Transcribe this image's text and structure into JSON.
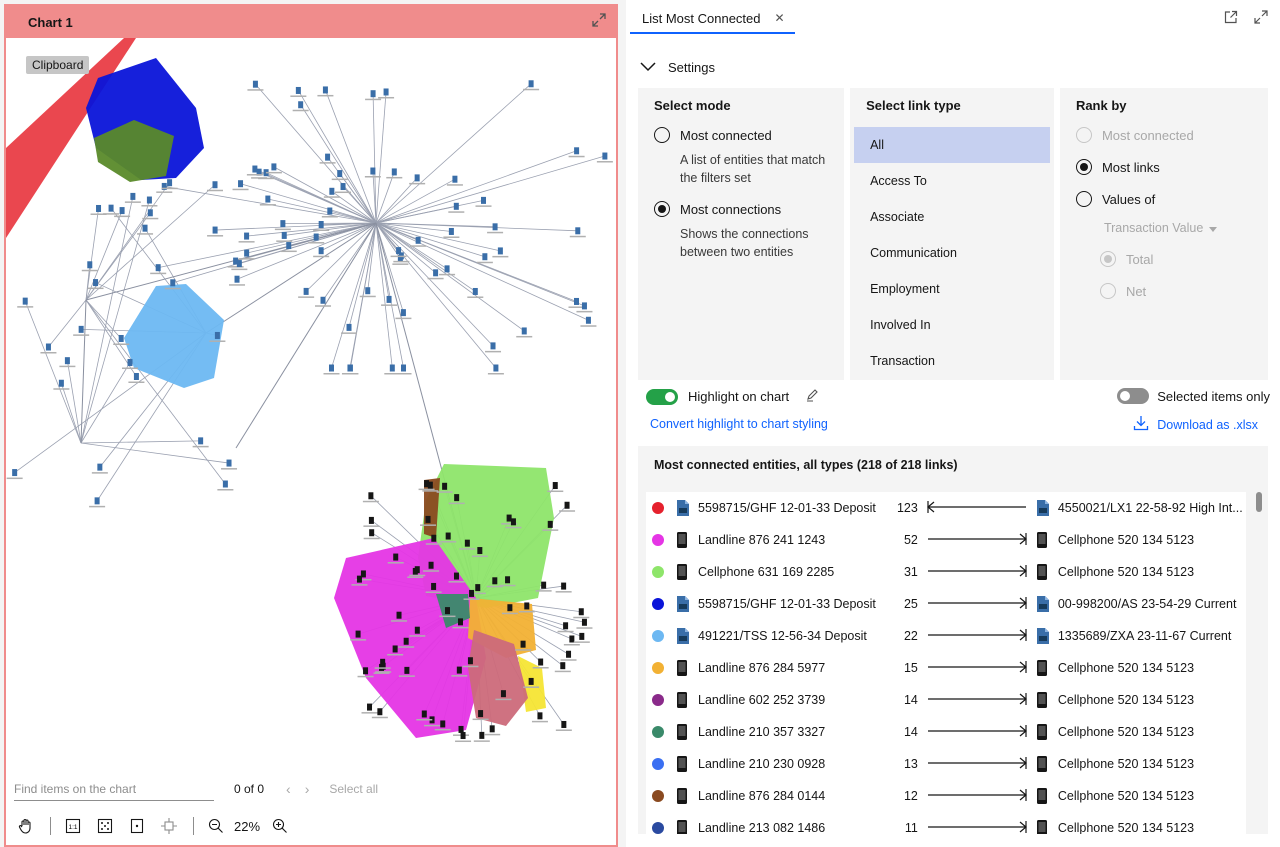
{
  "chart_panel": {
    "title": "Chart 1",
    "tooltip": "Clipboard",
    "find_placeholder": "Find items on the chart",
    "find_count": "0 of 0",
    "select_all": "Select all",
    "zoom": "22%"
  },
  "right_panel": {
    "tab_label": "List Most Connected",
    "settings_label": "Settings",
    "select_mode": {
      "heading": "Select mode",
      "options": [
        {
          "label": "Most connected",
          "desc": "A list of entities that match the filters set",
          "selected": false
        },
        {
          "label": "Most connections",
          "desc": "Shows the connections between two entities",
          "selected": true
        }
      ]
    },
    "link_type": {
      "heading": "Select link type",
      "items": [
        "All",
        "Access To",
        "Associate",
        "Communication",
        "Employment",
        "Involved In",
        "Transaction"
      ],
      "selected": "All"
    },
    "rank_by": {
      "heading": "Rank by",
      "options": [
        "Most connected",
        "Most links",
        "Values of"
      ],
      "value_field": "Transaction Value",
      "sub_options": [
        "Total",
        "Net"
      ]
    },
    "highlight_label": "Highlight on chart",
    "selected_only_label": "Selected items only",
    "convert_link": "Convert highlight to chart styling",
    "download_label": "Download as .xlsx",
    "results_title": "Most connected entities, all types (218 of 218 links)",
    "rows": [
      {
        "color": "#e5212d",
        "src_icon": "bank-account-icon",
        "source": "5598715/GHF 12-01-33 Deposit",
        "count": "123",
        "direction": "left",
        "tgt_icon": "bank-account-icon",
        "target": "4550021/LX1 22-58-92 High Int..."
      },
      {
        "color": "#e535e5",
        "src_icon": "phone-icon",
        "source": "Landline 876 241 1243",
        "count": "52",
        "direction": "right",
        "tgt_icon": "phone-icon",
        "target": "Cellphone 520 134 5123"
      },
      {
        "color": "#8ee56a",
        "src_icon": "phone-icon",
        "source": "Cellphone 631 169 2285",
        "count": "31",
        "direction": "right",
        "tgt_icon": "phone-icon",
        "target": "Cellphone 520 134 5123"
      },
      {
        "color": "#0a14d9",
        "src_icon": "bank-account-icon",
        "source": "5598715/GHF 12-01-33 Deposit",
        "count": "25",
        "direction": "right",
        "tgt_icon": "bank-account-icon",
        "target": "00-998200/AS 23-54-29 Current"
      },
      {
        "color": "#6db8f2",
        "src_icon": "bank-account-icon",
        "source": "491221/TSS 12-56-34 Deposit",
        "count": "22",
        "direction": "right",
        "tgt_icon": "bank-account-icon",
        "target": "1335689/ZXA 23-11-67 Current"
      },
      {
        "color": "#f2b134",
        "src_icon": "phone-icon",
        "source": "Landline 876 284 5977",
        "count": "15",
        "direction": "right",
        "tgt_icon": "phone-icon",
        "target": "Cellphone 520 134 5123"
      },
      {
        "color": "#8a2a8a",
        "src_icon": "phone-icon",
        "source": "Landline 602 252 3739",
        "count": "14",
        "direction": "right",
        "tgt_icon": "phone-icon",
        "target": "Cellphone 520 134 5123"
      },
      {
        "color": "#3a8a6a",
        "src_icon": "phone-icon",
        "source": "Landline 210 357 3327",
        "count": "14",
        "direction": "right",
        "tgt_icon": "phone-icon",
        "target": "Cellphone 520 134 5123"
      },
      {
        "color": "#3a6ff2",
        "src_icon": "phone-icon",
        "source": "Landline 210 230 0928",
        "count": "13",
        "direction": "right",
        "tgt_icon": "phone-icon",
        "target": "Cellphone 520 134 5123"
      },
      {
        "color": "#8a4a20",
        "src_icon": "phone-icon",
        "source": "Landline 876 284 0144",
        "count": "12",
        "direction": "right",
        "tgt_icon": "phone-icon",
        "target": "Cellphone 520 134 5123"
      },
      {
        "color": "#2a4aa0",
        "src_icon": "phone-icon",
        "source": "Landline 213 082 1486",
        "count": "11",
        "direction": "right",
        "tgt_icon": "phone-icon",
        "target": "Cellphone 520 134 5123"
      }
    ]
  }
}
